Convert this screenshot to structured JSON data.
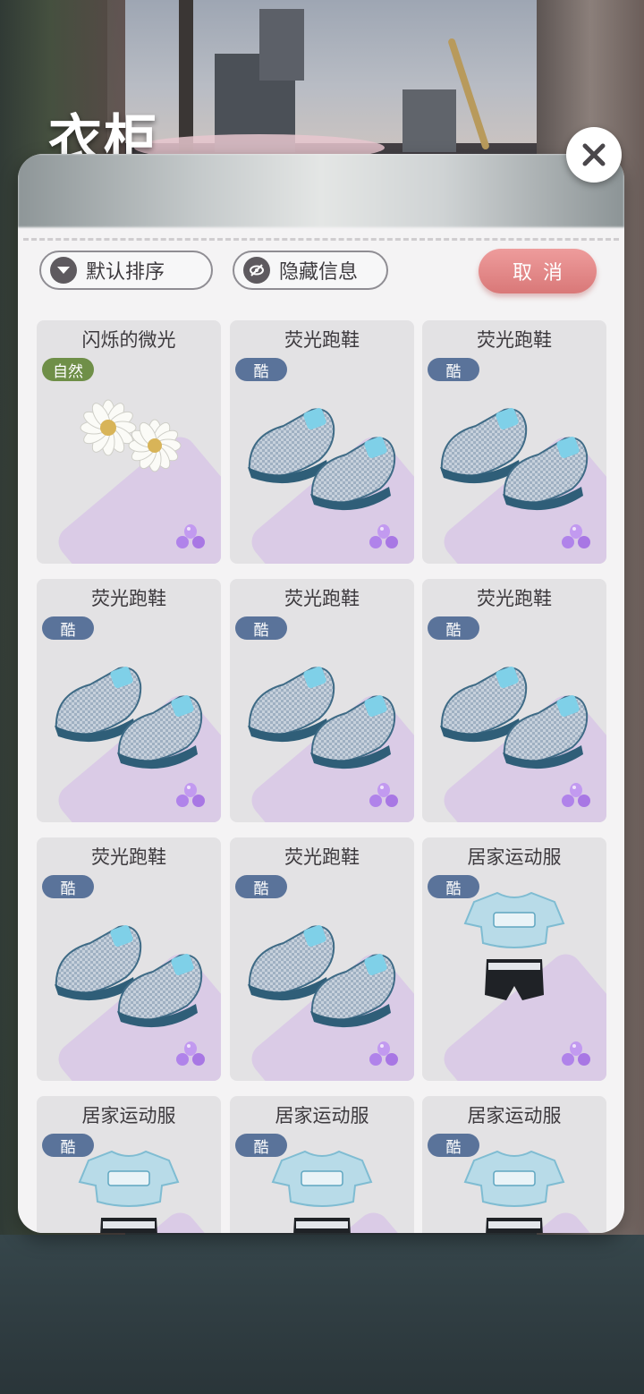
{
  "header": {
    "title": "衣柜"
  },
  "toolbar": {
    "sort_label": "默认排序",
    "hide_label": "隐藏信息",
    "cancel_label": "取消"
  },
  "items": [
    {
      "name": "闪烁的微光",
      "tag": "自然",
      "tag_type": "natural",
      "art": "daisy-earrings"
    },
    {
      "name": "荧光跑鞋",
      "tag": "酷",
      "tag_type": "cool",
      "art": "sneakers"
    },
    {
      "name": "荧光跑鞋",
      "tag": "酷",
      "tag_type": "cool",
      "art": "sneakers"
    },
    {
      "name": "荧光跑鞋",
      "tag": "酷",
      "tag_type": "cool",
      "art": "sneakers"
    },
    {
      "name": "荧光跑鞋",
      "tag": "酷",
      "tag_type": "cool",
      "art": "sneakers"
    },
    {
      "name": "荧光跑鞋",
      "tag": "酷",
      "tag_type": "cool",
      "art": "sneakers"
    },
    {
      "name": "荧光跑鞋",
      "tag": "酷",
      "tag_type": "cool",
      "art": "sneakers"
    },
    {
      "name": "荧光跑鞋",
      "tag": "酷",
      "tag_type": "cool",
      "art": "sneakers"
    },
    {
      "name": "居家运动服",
      "tag": "酷",
      "tag_type": "cool",
      "art": "sportswear"
    },
    {
      "name": "居家运动服",
      "tag": "酷",
      "tag_type": "cool",
      "art": "sportswear"
    },
    {
      "name": "居家运动服",
      "tag": "酷",
      "tag_type": "cool",
      "art": "sportswear"
    },
    {
      "name": "居家运动服",
      "tag": "酷",
      "tag_type": "cool",
      "art": "sportswear"
    }
  ],
  "colors": {
    "tag_cool": "#5a739a",
    "tag_natural": "#6f8f48",
    "cancel_button": "#e08a8a",
    "card_bg": "#e3e2e4",
    "card_corner": "#dacbe6"
  },
  "icons": {
    "sort": "chevron-down-icon",
    "hide": "eye-hidden-icon",
    "close": "close-icon",
    "gem": "purple-gem-icon"
  }
}
